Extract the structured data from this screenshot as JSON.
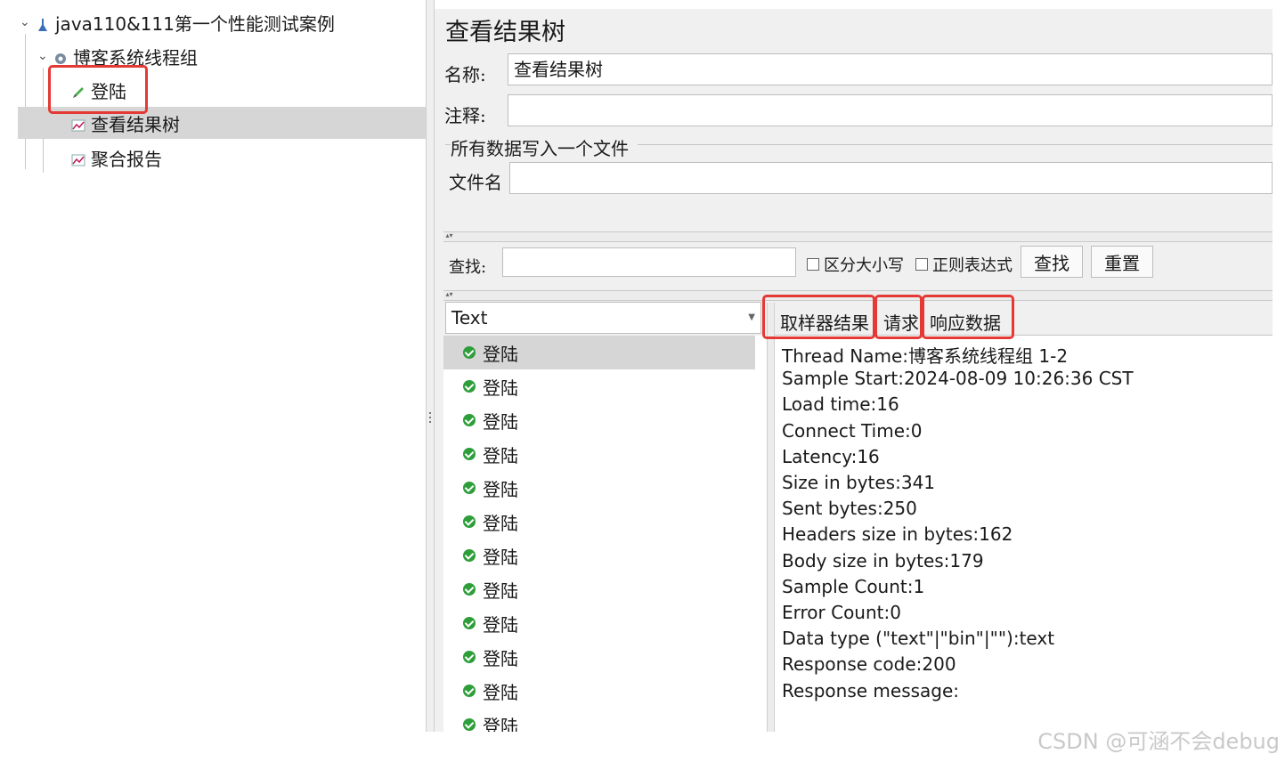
{
  "tree": {
    "root": "java110&111第一个性能测试案例",
    "thread_group": "博客系统线程组",
    "sampler": "登陆",
    "listener_tree": "查看结果树",
    "listener_report": "聚合报告"
  },
  "panel": {
    "title": "查看结果树",
    "name_label": "名称:",
    "name_value": "查看结果树",
    "comment_label": "注释:",
    "comment_value": "",
    "file_group_title": "所有数据写入一个文件",
    "filename_label": "文件名",
    "filename_value": ""
  },
  "search": {
    "label": "查找:",
    "value": "",
    "case_sensitive": "区分大小写",
    "regex": "正则表达式",
    "find_button": "查找",
    "reset_button": "重置"
  },
  "renderer": {
    "selected": "Text"
  },
  "samples": [
    "登陆",
    "登陆",
    "登陆",
    "登陆",
    "登陆",
    "登陆",
    "登陆",
    "登陆",
    "登陆",
    "登陆",
    "登陆",
    "登陆"
  ],
  "tabs": [
    "取样器结果",
    "请求",
    "响应数据"
  ],
  "result_lines": [
    "Thread Name:博客系统线程组 1-2",
    "Sample Start:2024-08-09 10:26:36 CST",
    "Load time:16",
    "Connect Time:0",
    "Latency:16",
    "Size in bytes:341",
    "Sent bytes:250",
    "Headers size in bytes:162",
    "Body size in bytes:179",
    "Sample Count:1",
    "Error Count:0",
    "Data type (\"text\"|\"bin\"|\"\"):text",
    "Response code:200",
    "Response message:"
  ],
  "watermark": "CSDN @可涵不会debug",
  "colors": {
    "highlight": "#e53935",
    "ok": "#2e9e3a",
    "tab_underline": "#3a78c9"
  }
}
